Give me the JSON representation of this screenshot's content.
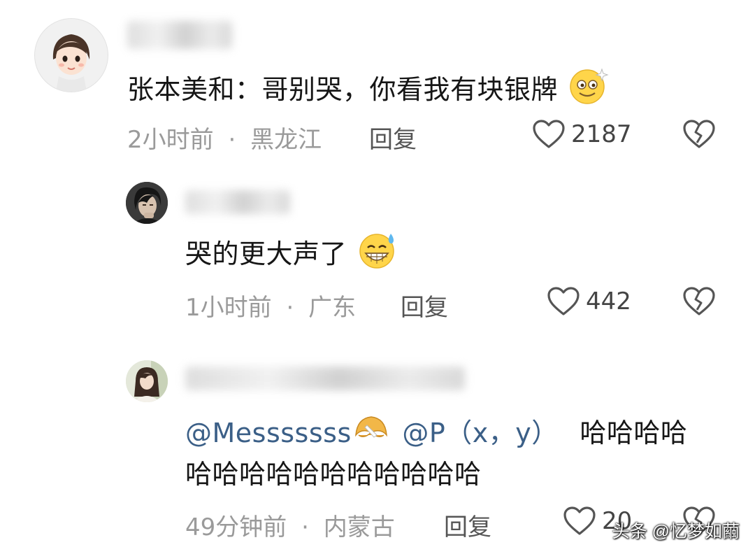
{
  "comments": [
    {
      "text": "张本美和：哥别哭，你看我有块银牌",
      "time": "2小时前",
      "location": "黑龙江",
      "reply": "回复",
      "likes": "2187"
    },
    {
      "text": "哭的更大声了",
      "time": "1小时前",
      "location": "广东",
      "reply": "回复",
      "likes": "442"
    },
    {
      "mention1": "@Messsssss",
      "mention2": "@P（x，y）",
      "text_a": "哈哈哈哈",
      "text_b": "哈哈哈哈哈哈哈哈哈哈哈",
      "time": "49分钟前",
      "location": "内蒙古",
      "reply": "回复",
      "likes": "20"
    }
  ],
  "meta_separator": "·",
  "icons": {
    "like": "heart-outline-icon",
    "dislike": "broken-heart-icon"
  },
  "watermark": "头条 @忆梦如繭"
}
